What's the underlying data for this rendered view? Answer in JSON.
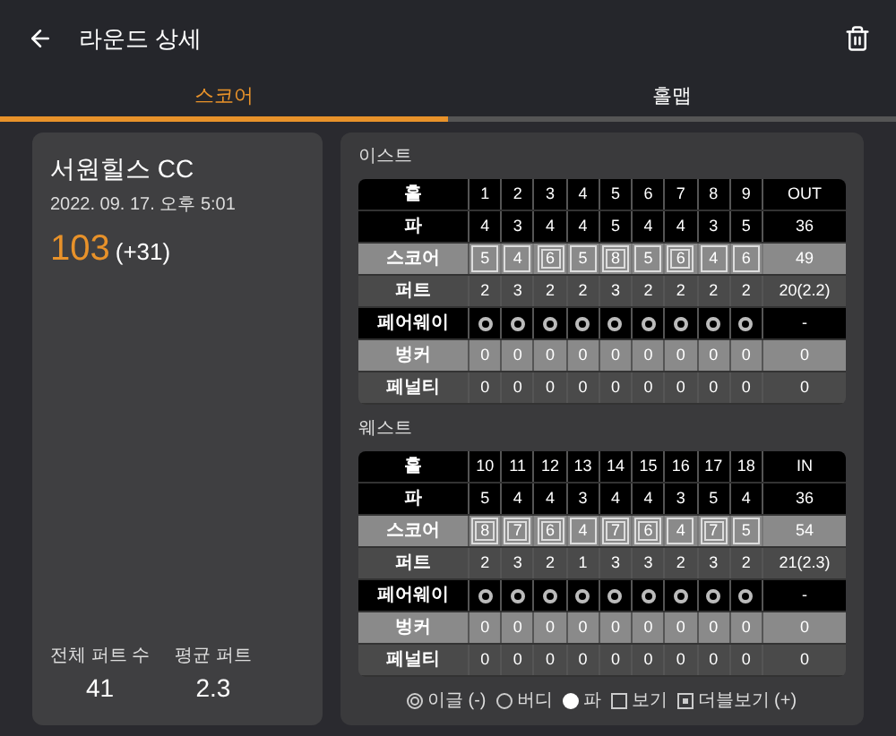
{
  "header": {
    "title": "라운드 상세"
  },
  "tabs": [
    {
      "label": "스코어",
      "selected": true
    },
    {
      "label": "홀맵",
      "selected": false
    }
  ],
  "summary": {
    "course": "서원힐스 CC",
    "datetime": "2022. 09. 17. 오후 5:01",
    "score": "103",
    "over": "(+31)",
    "stats": [
      {
        "label": "전체 퍼트 수",
        "value": "41"
      },
      {
        "label": "평균 퍼트",
        "value": "2.3"
      }
    ]
  },
  "sections": [
    {
      "title": "이스트",
      "row_labels": [
        "홀",
        "파",
        "스코어",
        "퍼트",
        "페어웨이",
        "벙커",
        "페널티"
      ],
      "holes": [
        "1",
        "2",
        "3",
        "4",
        "5",
        "6",
        "7",
        "8",
        "9"
      ],
      "hole_total": "OUT",
      "par": [
        "4",
        "3",
        "4",
        "4",
        "5",
        "4",
        "4",
        "3",
        "5"
      ],
      "par_total": "36",
      "scores": [
        {
          "value": "5",
          "kind": "bogey"
        },
        {
          "value": "4",
          "kind": "bogey"
        },
        {
          "value": "6",
          "kind": "double"
        },
        {
          "value": "5",
          "kind": "bogey"
        },
        {
          "value": "8",
          "kind": "double"
        },
        {
          "value": "5",
          "kind": "bogey"
        },
        {
          "value": "6",
          "kind": "double"
        },
        {
          "value": "4",
          "kind": "bogey"
        },
        {
          "value": "6",
          "kind": "bogey"
        }
      ],
      "score_total": "49",
      "putts": [
        "2",
        "3",
        "2",
        "2",
        "3",
        "2",
        "2",
        "2",
        "2"
      ],
      "putts_total": "20(2.2)",
      "fairway": [
        {
          "kind": "hit"
        },
        {
          "kind": "hit"
        },
        {
          "kind": "hit"
        },
        {
          "kind": "hit"
        },
        {
          "kind": "hit"
        },
        {
          "kind": "hit"
        },
        {
          "kind": "hit"
        },
        {
          "kind": "hit"
        },
        {
          "kind": "hit"
        }
      ],
      "fairway_total": "-",
      "bunker": [
        "0",
        "0",
        "0",
        "0",
        "0",
        "0",
        "0",
        "0",
        "0"
      ],
      "bunker_total": "0",
      "penalty": [
        "0",
        "0",
        "0",
        "0",
        "0",
        "0",
        "0",
        "0",
        "0"
      ],
      "penalty_total": "0"
    },
    {
      "title": "웨스트",
      "row_labels": [
        "홀",
        "파",
        "스코어",
        "퍼트",
        "페어웨이",
        "벙커",
        "페널티"
      ],
      "holes": [
        "10",
        "11",
        "12",
        "13",
        "14",
        "15",
        "16",
        "17",
        "18"
      ],
      "hole_total": "IN",
      "par": [
        "5",
        "4",
        "4",
        "3",
        "4",
        "4",
        "3",
        "5",
        "4"
      ],
      "par_total": "36",
      "scores": [
        {
          "value": "8",
          "kind": "double"
        },
        {
          "value": "7",
          "kind": "double"
        },
        {
          "value": "6",
          "kind": "double"
        },
        {
          "value": "4",
          "kind": "bogey"
        },
        {
          "value": "7",
          "kind": "double"
        },
        {
          "value": "6",
          "kind": "double"
        },
        {
          "value": "4",
          "kind": "bogey"
        },
        {
          "value": "7",
          "kind": "double"
        },
        {
          "value": "5",
          "kind": "bogey"
        }
      ],
      "score_total": "54",
      "putts": [
        "2",
        "3",
        "2",
        "1",
        "3",
        "3",
        "2",
        "3",
        "2"
      ],
      "putts_total": "21(2.3)",
      "fairway": [
        {
          "kind": "hit"
        },
        {
          "kind": "hit"
        },
        {
          "kind": "hit"
        },
        {
          "kind": "hit"
        },
        {
          "kind": "hit"
        },
        {
          "kind": "hit"
        },
        {
          "kind": "hit"
        },
        {
          "kind": "hit"
        },
        {
          "kind": "hit"
        }
      ],
      "fairway_total": "-",
      "bunker": [
        "0",
        "0",
        "0",
        "0",
        "0",
        "0",
        "0",
        "0",
        "0"
      ],
      "bunker_total": "0",
      "penalty": [
        "0",
        "0",
        "0",
        "0",
        "0",
        "0",
        "0",
        "0",
        "0"
      ],
      "penalty_total": "0"
    }
  ],
  "legend": [
    {
      "kind": "eagle",
      "label": "이글 (-)"
    },
    {
      "kind": "birdie",
      "label": "버디"
    },
    {
      "kind": "par",
      "label": "파"
    },
    {
      "kind": "bogey",
      "label": "보기"
    },
    {
      "kind": "double",
      "label": "더블보기 (+)"
    }
  ]
}
